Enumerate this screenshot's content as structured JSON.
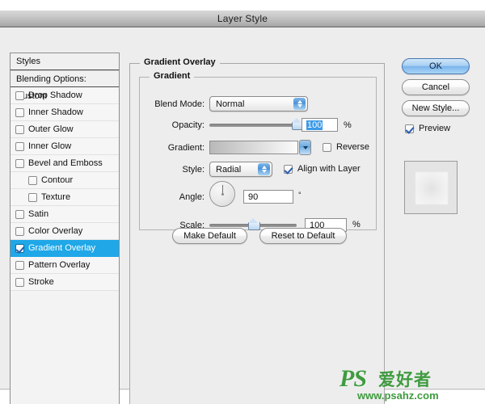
{
  "window": {
    "title": "Layer Style"
  },
  "styles_panel": {
    "header": "Styles",
    "blending_options": "Blending Options: Custom",
    "items": [
      {
        "label": "Drop Shadow",
        "checked": false,
        "selected": false,
        "indent": false
      },
      {
        "label": "Inner Shadow",
        "checked": false,
        "selected": false,
        "indent": false
      },
      {
        "label": "Outer Glow",
        "checked": false,
        "selected": false,
        "indent": false
      },
      {
        "label": "Inner Glow",
        "checked": false,
        "selected": false,
        "indent": false
      },
      {
        "label": "Bevel and Emboss",
        "checked": false,
        "selected": false,
        "indent": false
      },
      {
        "label": "Contour",
        "checked": false,
        "selected": false,
        "indent": true
      },
      {
        "label": "Texture",
        "checked": false,
        "selected": false,
        "indent": true
      },
      {
        "label": "Satin",
        "checked": false,
        "selected": false,
        "indent": false
      },
      {
        "label": "Color Overlay",
        "checked": false,
        "selected": false,
        "indent": false
      },
      {
        "label": "Gradient Overlay",
        "checked": true,
        "selected": true,
        "indent": false
      },
      {
        "label": "Pattern Overlay",
        "checked": false,
        "selected": false,
        "indent": false
      },
      {
        "label": "Stroke",
        "checked": false,
        "selected": false,
        "indent": false
      }
    ],
    "selected_color": "#1fa7e8"
  },
  "main": {
    "group_title": "Gradient Overlay",
    "sub_group_title": "Gradient",
    "blend_mode": {
      "label": "Blend Mode:",
      "value": "Normal"
    },
    "opacity": {
      "label": "Opacity:",
      "value": "100",
      "unit": "%",
      "slider_percent": 100
    },
    "gradient": {
      "label": "Gradient:",
      "from_color": "#b9b9b9",
      "to_color": "#fbfbfb",
      "reverse_label": "Reverse",
      "reverse_checked": false
    },
    "style": {
      "label": "Style:",
      "value": "Radial",
      "align_label": "Align with Layer",
      "align_checked": true
    },
    "angle": {
      "label": "Angle:",
      "value": "90",
      "unit": "°",
      "degrees": 90
    },
    "scale": {
      "label": "Scale:",
      "value": "100",
      "unit": "%",
      "slider_percent": 50
    },
    "make_default": "Make Default",
    "reset_to_default": "Reset to Default"
  },
  "actions": {
    "ok": "OK",
    "cancel": "Cancel",
    "new_style": "New Style...",
    "preview_label": "Preview",
    "preview_checked": true
  },
  "watermark": {
    "ps": "PS",
    "cn": "爱好者",
    "url": "www.psahz.com",
    "color": "#3f9b3f"
  }
}
